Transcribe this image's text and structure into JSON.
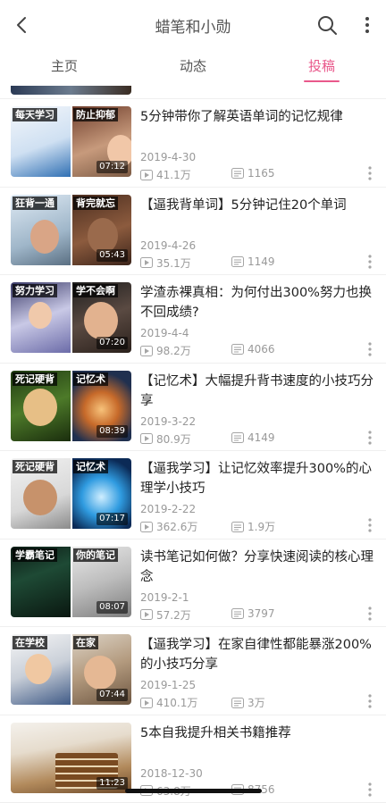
{
  "header": {
    "title": "蜡笔和小勋",
    "icons": [
      "back-arrow-icon",
      "search-icon",
      "more-vertical-icon"
    ]
  },
  "tabs": [
    {
      "label": "主页",
      "active": false
    },
    {
      "label": "动态",
      "active": false
    },
    {
      "label": "投稿",
      "active": true
    }
  ],
  "colors": {
    "accent": "#e9588b",
    "meta": "#999999",
    "text": "#222222"
  },
  "videos": [
    {
      "thumb_left": "每天学习",
      "thumb_right": "防止抑郁",
      "duration": "07:12",
      "title": "5分钟带你了解英语单词的记忆规律",
      "date": "2019-4-30",
      "plays": "41.1万",
      "danmaku": "1165"
    },
    {
      "thumb_left": "狂背一通",
      "thumb_right": "背完就忘",
      "duration": "05:43",
      "title": "【逼我背单词】5分钟记住20个单词",
      "date": "2019-4-26",
      "plays": "35.1万",
      "danmaku": "1149"
    },
    {
      "thumb_left": "努力学习",
      "thumb_right": "学不会啊",
      "duration": "07:20",
      "title": "学渣赤裸真相：为何付出300%努力也换不回成绩?",
      "date": "2019-4-4",
      "plays": "98.2万",
      "danmaku": "4066"
    },
    {
      "thumb_left": "死记硬背",
      "thumb_right": "记忆术",
      "duration": "08:39",
      "title": "【记忆术】大幅提升背书速度的小技巧分享",
      "date": "2019-3-22",
      "plays": "80.9万",
      "danmaku": "4149"
    },
    {
      "thumb_left": "死记硬背",
      "thumb_right": "记忆术",
      "duration": "07:17",
      "title": "【逼我学习】让记忆效率提升300%的心理学小技巧",
      "date": "2019-2-22",
      "plays": "362.6万",
      "danmaku": "1.9万"
    },
    {
      "thumb_left": "学霸笔记",
      "thumb_right": "你的笔记",
      "duration": "08:07",
      "title": "读书笔记如何做？分享快速阅读的核心理念",
      "date": "2019-2-1",
      "plays": "57.2万",
      "danmaku": "3797"
    },
    {
      "thumb_left": "在学校",
      "thumb_right": "在家",
      "duration": "07:44",
      "title": "【逼我学习】在家自律性都能暴涨200%的小技巧分享",
      "date": "2019-1-25",
      "plays": "410.1万",
      "danmaku": "3万"
    },
    {
      "thumb_left": "",
      "thumb_right": "",
      "duration": "11:23",
      "title": "5本自我提升相关书籍推荐",
      "date": "2018-12-30",
      "plays": "63.8万",
      "danmaku": "8756"
    }
  ]
}
